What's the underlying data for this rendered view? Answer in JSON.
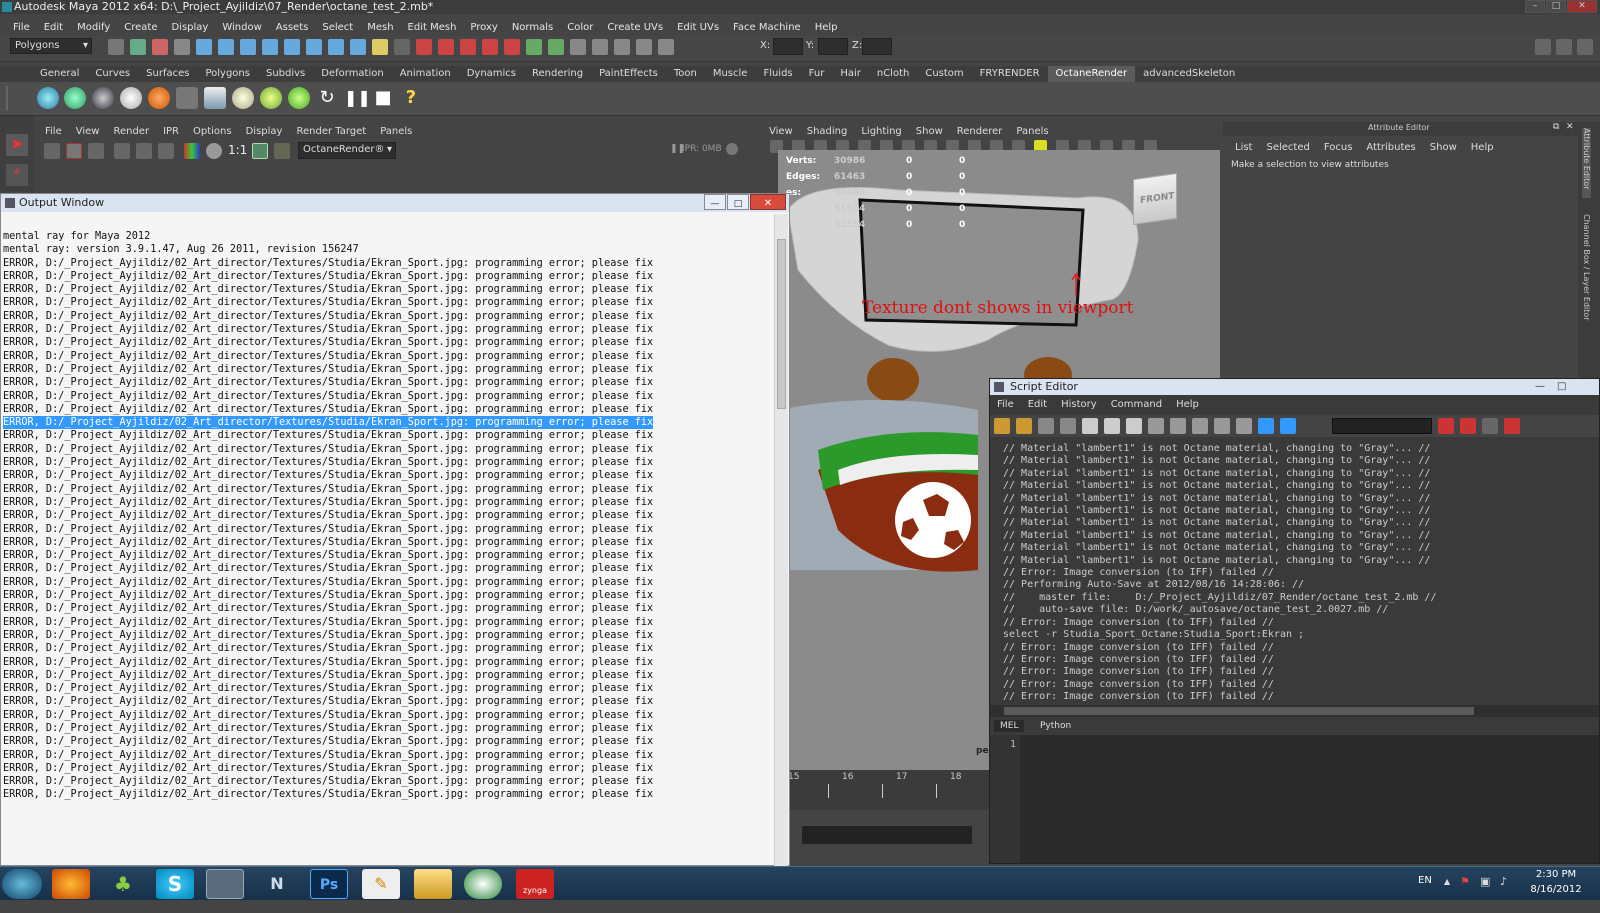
{
  "window": {
    "title": "Autodesk Maya 2012 x64: D:\\_Project_Ayjildiz\\07_Render\\octane_test_2.mb*"
  },
  "menubar": [
    "File",
    "Edit",
    "Modify",
    "Create",
    "Display",
    "Window",
    "Assets",
    "Select",
    "Mesh",
    "Edit Mesh",
    "Proxy",
    "Normals",
    "Color",
    "Create UVs",
    "Edit UVs",
    "Face Machine",
    "Help"
  ],
  "toolbar": {
    "mode": "Polygons",
    "x_label": "X:",
    "y_label": "Y:",
    "z_label": "Z:"
  },
  "shelf_tabs": [
    "General",
    "Curves",
    "Surfaces",
    "Polygons",
    "Subdivs",
    "Deformation",
    "Animation",
    "Dynamics",
    "Rendering",
    "PaintEffects",
    "Toon",
    "Muscle",
    "Fluids",
    "Fur",
    "Hair",
    "nCloth",
    "Custom",
    "FRYRENDER",
    "OctaneRender",
    "advancedSkeleton"
  ],
  "active_shelf": "OctaneRender",
  "ipr_menu": [
    "File",
    "View",
    "Render",
    "IPR",
    "Options",
    "Display",
    "Render Target",
    "Panels"
  ],
  "ipr_toolbar": {
    "ratio": "1:1",
    "renderer": "OctaneRender®",
    "ipr_status": "IPR: 0MB"
  },
  "viewport": {
    "menu": [
      "View",
      "Shading",
      "Lighting",
      "Show",
      "Renderer",
      "Panels"
    ],
    "hud": [
      {
        "label": "Verts:",
        "v1": "30986",
        "v2": "0",
        "v3": "0"
      },
      {
        "label": "Edges:",
        "v1": "61463",
        "v2": "0",
        "v3": "0"
      },
      {
        "label": "es:",
        "v1": "30480",
        "v2": "0",
        "v3": "0"
      },
      {
        "label": "",
        "v1": "61614",
        "v2": "0",
        "v3": "0"
      },
      {
        "label": "",
        "v1": "32554",
        "v2": "0",
        "v3": "0"
      }
    ],
    "viewcube": "FRONT",
    "annotation": "Texture dont shows in viewport",
    "persp_label": "per",
    "timeline": [
      "15",
      "16",
      "17",
      "18"
    ]
  },
  "attribute_editor": {
    "title": "Attribute Editor",
    "menu": [
      "List",
      "Selected",
      "Focus",
      "Attributes",
      "Show",
      "Help"
    ],
    "message": "Make a selection to view attributes"
  },
  "side_tabs": {
    "a": "Attribute Editor",
    "b": "Channel Box / Layer Editor"
  },
  "output_window": {
    "title": "Output Window",
    "lines": [
      "mental ray for Maya 2012",
      "mental ray: version 3.9.1.47, Aug 26 2011, revision 156247",
      "ERROR, D:/_Project_Ayjildiz/02_Art_director/Textures/Studia/Ekran_Sport.jpg: programming error; please fix",
      "ERROR, D:/_Project_Ayjildiz/02_Art_director/Textures/Studia/Ekran_Sport.jpg: programming error; please fix",
      "ERROR, D:/_Project_Ayjildiz/02_Art_director/Textures/Studia/Ekran_Sport.jpg: programming error; please fix",
      "ERROR, D:/_Project_Ayjildiz/02_Art_director/Textures/Studia/Ekran_Sport.jpg: programming error; please fix",
      "ERROR, D:/_Project_Ayjildiz/02_Art_director/Textures/Studia/Ekran_Sport.jpg: programming error; please fix",
      "ERROR, D:/_Project_Ayjildiz/02_Art_director/Textures/Studia/Ekran_Sport.jpg: programming error; please fix",
      "ERROR, D:/_Project_Ayjildiz/02_Art_director/Textures/Studia/Ekran_Sport.jpg: programming error; please fix",
      "ERROR, D:/_Project_Ayjildiz/02_Art_director/Textures/Studia/Ekran_Sport.jpg: programming error; please fix",
      "ERROR, D:/_Project_Ayjildiz/02_Art_director/Textures/Studia/Ekran_Sport.jpg: programming error; please fix",
      "ERROR, D:/_Project_Ayjildiz/02_Art_director/Textures/Studia/Ekran_Sport.jpg: programming error; please fix",
      "ERROR, D:/_Project_Ayjildiz/02_Art_director/Textures/Studia/Ekran_Sport.jpg: programming error; please fix",
      "ERROR, D:/_Project_Ayjildiz/02_Art_director/Textures/Studia/Ekran_Sport.jpg: programming error; please fix",
      "ERROR, D:/_Project_Ayjildiz/02_Art_director/Textures/Studia/Ekran_Sport.jpg: programming error; please fix",
      "ERROR, D:/_Project_Ayjildiz/02_Art_director/Textures/Studia/Ekran_Sport.jpg: programming error; please fix",
      "ERROR, D:/_Project_Ayjildiz/02_Art_director/Textures/Studia/Ekran_Sport.jpg: programming error; please fix",
      "ERROR, D:/_Project_Ayjildiz/02_Art_director/Textures/Studia/Ekran_Sport.jpg: programming error; please fix",
      "ERROR, D:/_Project_Ayjildiz/02_Art_director/Textures/Studia/Ekran_Sport.jpg: programming error; please fix",
      "ERROR, D:/_Project_Ayjildiz/02_Art_director/Textures/Studia/Ekran_Sport.jpg: programming error; please fix",
      "ERROR, D:/_Project_Ayjildiz/02_Art_director/Textures/Studia/Ekran_Sport.jpg: programming error; please fix",
      "ERROR, D:/_Project_Ayjildiz/02_Art_director/Textures/Studia/Ekran_Sport.jpg: programming error; please fix",
      "ERROR, D:/_Project_Ayjildiz/02_Art_director/Textures/Studia/Ekran_Sport.jpg: programming error; please fix",
      "ERROR, D:/_Project_Ayjildiz/02_Art_director/Textures/Studia/Ekran_Sport.jpg: programming error; please fix",
      "ERROR, D:/_Project_Ayjildiz/02_Art_director/Textures/Studia/Ekran_Sport.jpg: programming error; please fix",
      "ERROR, D:/_Project_Ayjildiz/02_Art_director/Textures/Studia/Ekran_Sport.jpg: programming error; please fix",
      "ERROR, D:/_Project_Ayjildiz/02_Art_director/Textures/Studia/Ekran_Sport.jpg: programming error; please fix",
      "ERROR, D:/_Project_Ayjildiz/02_Art_director/Textures/Studia/Ekran_Sport.jpg: programming error; please fix",
      "ERROR, D:/_Project_Ayjildiz/02_Art_director/Textures/Studia/Ekran_Sport.jpg: programming error; please fix",
      "ERROR, D:/_Project_Ayjildiz/02_Art_director/Textures/Studia/Ekran_Sport.jpg: programming error; please fix",
      "ERROR, D:/_Project_Ayjildiz/02_Art_director/Textures/Studia/Ekran_Sport.jpg: programming error; please fix",
      "ERROR, D:/_Project_Ayjildiz/02_Art_director/Textures/Studia/Ekran_Sport.jpg: programming error; please fix",
      "ERROR, D:/_Project_Ayjildiz/02_Art_director/Textures/Studia/Ekran_Sport.jpg: programming error; please fix",
      "ERROR, D:/_Project_Ayjildiz/02_Art_director/Textures/Studia/Ekran_Sport.jpg: programming error; please fix",
      "ERROR, D:/_Project_Ayjildiz/02_Art_director/Textures/Studia/Ekran_Sport.jpg: programming error; please fix",
      "ERROR, D:/_Project_Ayjildiz/02_Art_director/Textures/Studia/Ekran_Sport.jpg: programming error; please fix",
      "ERROR, D:/_Project_Ayjildiz/02_Art_director/Textures/Studia/Ekran_Sport.jpg: programming error; please fix",
      "ERROR, D:/_Project_Ayjildiz/02_Art_director/Textures/Studia/Ekran_Sport.jpg: programming error; please fix",
      "ERROR, D:/_Project_Ayjildiz/02_Art_director/Textures/Studia/Ekran_Sport.jpg: programming error; please fix",
      "ERROR, D:/_Project_Ayjildiz/02_Art_director/Textures/Studia/Ekran_Sport.jpg: programming error; please fix",
      "ERROR, D:/_Project_Ayjildiz/02_Art_director/Textures/Studia/Ekran_Sport.jpg: programming error; please fix",
      "ERROR, D:/_Project_Ayjildiz/02_Art_director/Textures/Studia/Ekran_Sport.jpg: programming error; please fix",
      "ERROR, D:/_Project_Ayjildiz/02_Art_director/Textures/Studia/Ekran_Sport.jpg: programming error; please fix"
    ],
    "highlighted_index": 14
  },
  "script_editor": {
    "title": "Script Editor",
    "menu": [
      "File",
      "Edit",
      "History",
      "Command",
      "Help"
    ],
    "history": [
      "// Material \"lambert1\" is not Octane material, changing to \"Gray\"... //",
      "// Material \"lambert1\" is not Octane material, changing to \"Gray\"... //",
      "// Material \"lambert1\" is not Octane material, changing to \"Gray\"... //",
      "// Material \"lambert1\" is not Octane material, changing to \"Gray\"... //",
      "// Material \"lambert1\" is not Octane material, changing to \"Gray\"... //",
      "// Material \"lambert1\" is not Octane material, changing to \"Gray\"... //",
      "// Material \"lambert1\" is not Octane material, changing to \"Gray\"... //",
      "// Material \"lambert1\" is not Octane material, changing to \"Gray\"... //",
      "// Material \"lambert1\" is not Octane material, changing to \"Gray\"... //",
      "// Material \"lambert1\" is not Octane material, changing to \"Gray\"... //",
      "// Error: Image conversion (to IFF) failed //",
      "// Performing Auto-Save at 2012/08/16 14:28:06: //",
      "//    master file:    D:/_Project_Ayjildiz/07_Render/octane_test_2.mb //",
      "//    auto-save file: D:/work/_autosave/octane_test_2.0027.mb //",
      "// Error: Image conversion (to IFF) failed //",
      "select -r Studia_Sport_Octane:Studia_Sport:Ekran ;",
      "// Error: Image conversion (to IFF) failed //",
      "// Error: Image conversion (to IFF) failed //",
      "// Error: Image conversion (to IFF) failed //",
      "// Error: Image conversion (to IFF) failed //",
      "// Error: Image conversion (to IFF) failed //"
    ],
    "tabs": [
      "MEL",
      "Python"
    ],
    "line_number": "1"
  },
  "taskbar": {
    "lang": "EN",
    "time": "2:30 PM",
    "date": "8/16/2012",
    "zynga_label": "zynga"
  }
}
